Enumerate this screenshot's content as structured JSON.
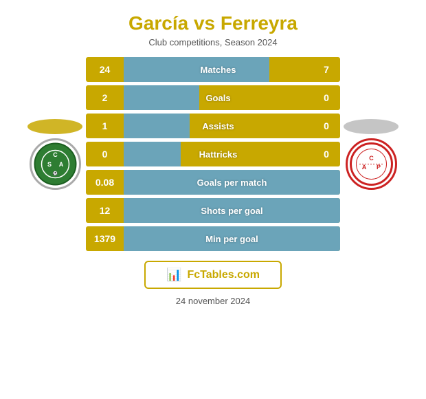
{
  "header": {
    "title": "García vs Ferreyra",
    "subtitle": "Club competitions, Season 2024"
  },
  "stats": [
    {
      "label": "Matches",
      "left": "24",
      "right": "7",
      "fill_pct": 77,
      "single": false
    },
    {
      "label": "Goals",
      "left": "2",
      "right": "0",
      "fill_pct": 40,
      "single": false
    },
    {
      "label": "Assists",
      "left": "1",
      "right": "0",
      "fill_pct": 35,
      "single": false
    },
    {
      "label": "Hattricks",
      "left": "0",
      "right": "0",
      "fill_pct": 30,
      "single": false
    },
    {
      "label": "Goals per match",
      "left": "0.08",
      "right": "",
      "fill_pct": 100,
      "single": true
    },
    {
      "label": "Shots per goal",
      "left": "12",
      "right": "",
      "fill_pct": 100,
      "single": true
    },
    {
      "label": "Min per goal",
      "left": "1379",
      "right": "",
      "fill_pct": 100,
      "single": true
    }
  ],
  "fctables": {
    "text": "FcTables.com"
  },
  "footer": {
    "date": "24 november 2024"
  },
  "colors": {
    "gold": "#c8a800",
    "blue": "#5ba3d9"
  }
}
